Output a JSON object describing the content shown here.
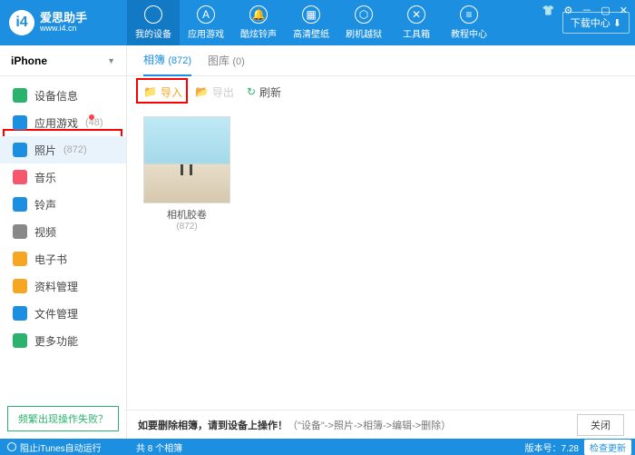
{
  "app": {
    "title": "爱思助手",
    "url": "www.i4.cn"
  },
  "nav": [
    {
      "label": "我的设备",
      "icon": "apple"
    },
    {
      "label": "应用游戏",
      "icon": "apps"
    },
    {
      "label": "酷炫铃声",
      "icon": "bell"
    },
    {
      "label": "高清壁纸",
      "icon": "image"
    },
    {
      "label": "刷机越狱",
      "icon": "box"
    },
    {
      "label": "工具箱",
      "icon": "tools"
    },
    {
      "label": "教程中心",
      "icon": "book"
    }
  ],
  "download_btn": "下载中心",
  "device": "iPhone",
  "sidebar": [
    {
      "label": "设备信息",
      "color": "#2bb36e"
    },
    {
      "label": "应用游戏",
      "color": "#1d8fe1",
      "count": "(48)",
      "badge": true
    },
    {
      "label": "照片",
      "color": "#1d8fe1",
      "count": "(872)",
      "selected": true
    },
    {
      "label": "音乐",
      "color": "#f5576c"
    },
    {
      "label": "铃声",
      "color": "#1d8fe1"
    },
    {
      "label": "视频",
      "color": "#888"
    },
    {
      "label": "电子书",
      "color": "#f5a623"
    },
    {
      "label": "资料管理",
      "color": "#f5a623"
    },
    {
      "label": "文件管理",
      "color": "#1d8fe1"
    },
    {
      "label": "更多功能",
      "color": "#2bb36e"
    }
  ],
  "sidebar_fail": "频繁出现操作失败？",
  "tabs": [
    {
      "label": "相簿",
      "count": "(872)",
      "active": true
    },
    {
      "label": "图库",
      "count": "(0)"
    }
  ],
  "toolbar": {
    "import": "导入",
    "export": "导出",
    "refresh": "刷新"
  },
  "album": {
    "name": "相机胶卷",
    "count": "(872)"
  },
  "hint": {
    "bold": "如要删除相簿，请到设备上操作！",
    "detail": "（\"设备\"->照片->相簿->编辑->删除）",
    "close": "关闭"
  },
  "status": {
    "itunes": "阻止iTunes自动运行",
    "count": "共 8 个相簿",
    "version_label": "版本号：",
    "version": "7.28",
    "update": "检查更新"
  }
}
